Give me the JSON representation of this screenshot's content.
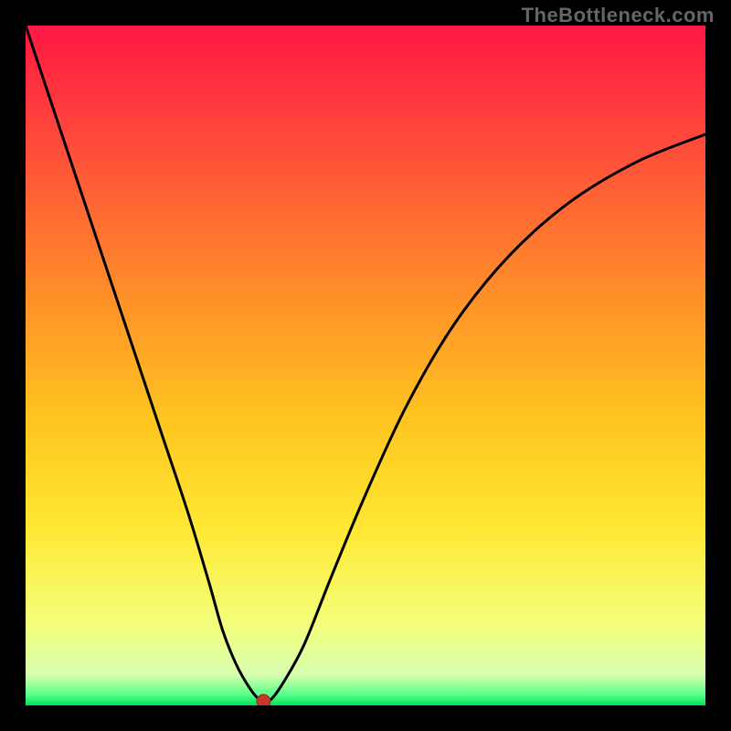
{
  "branding": {
    "watermark": "TheBottleneck.com"
  },
  "chart_data": {
    "type": "line",
    "title": "",
    "xlabel": "",
    "ylabel": "",
    "xlim": [
      0,
      100
    ],
    "ylim": [
      0,
      100
    ],
    "grid": false,
    "background_gradient": {
      "top_color": "#ff1b48",
      "mid_upper_color": "#ff7a2f",
      "mid_color": "#ffd200",
      "mid_lower_color": "#f4ff4d",
      "base_band_color": "#00ff66",
      "stops": [
        {
          "pos": 0.0,
          "color": "#ff1744"
        },
        {
          "pos": 0.18,
          "color": "#ff4d3a"
        },
        {
          "pos": 0.38,
          "color": "#ff8a2a"
        },
        {
          "pos": 0.58,
          "color": "#ffc51f"
        },
        {
          "pos": 0.74,
          "color": "#ffe833"
        },
        {
          "pos": 0.88,
          "color": "#f4ff7a"
        },
        {
          "pos": 0.955,
          "color": "#d8ffb0"
        },
        {
          "pos": 0.985,
          "color": "#55ff88"
        },
        {
          "pos": 1.0,
          "color": "#00e060"
        }
      ]
    },
    "series": [
      {
        "name": "bottleneck-curve",
        "type": "line",
        "color": "#000000",
        "x": [
          0,
          4,
          8,
          12,
          16,
          20,
          24,
          27,
          29,
          31,
          33,
          34.5,
          36,
          38,
          41,
          45,
          50,
          56,
          63,
          71,
          80,
          90,
          100
        ],
        "values": [
          100,
          88,
          76,
          64,
          52,
          40,
          28,
          18,
          11,
          6,
          2.5,
          0.8,
          0.8,
          3.5,
          9,
          19,
          31,
          44,
          56,
          66,
          74,
          80,
          84
        ]
      }
    ],
    "marker": {
      "name": "minimum-marker",
      "x": 35,
      "y": 0.6,
      "color": "#c0392b",
      "radius_px": 7.5
    },
    "curve_minimum": {
      "x": 35,
      "y": 0.6
    }
  }
}
